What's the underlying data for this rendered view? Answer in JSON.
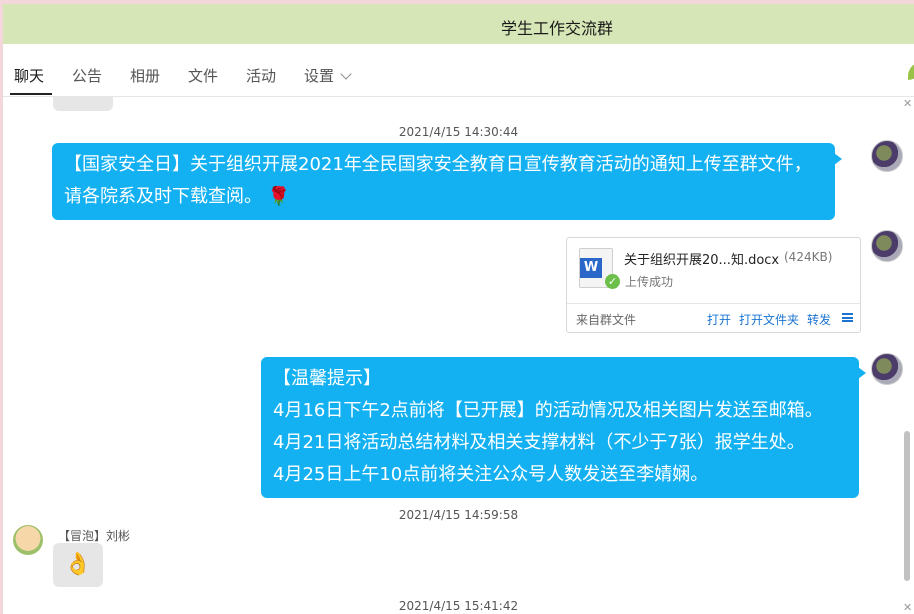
{
  "window": {
    "title": "学生工作交流群"
  },
  "tabs": [
    {
      "label": "聊天"
    },
    {
      "label": "公告"
    },
    {
      "label": "相册"
    },
    {
      "label": "文件"
    },
    {
      "label": "活动"
    },
    {
      "label": "设置"
    }
  ],
  "messages": {
    "ts1": "2021/4/15 14:30:44",
    "msg1_line1": "【国家安全日】关于组织开展2021年全民国家安全教育日宣传教育活动的通知上传至群文件，",
    "msg1_line2": "请各院系及时下载查阅。",
    "msg1_emoji": "🌹",
    "file": {
      "name": "关于组织开展20...知.docx",
      "size": "(424KB)",
      "status": "上传成功",
      "source": "来自群文件",
      "open": "打开",
      "open_folder": "打开文件夹",
      "forward": "转发"
    },
    "notice": {
      "line1": "【温馨提示】",
      "line2": "4月16日下午2点前将【已开展】的活动情况及相关图片发送至邮箱。",
      "line3": "4月21日将活动总结材料及相关支撑材料（不少于7张）报学生处。",
      "line4": "4月25日上午10点前将关注公众号人数发送至李婧娴。"
    },
    "ts2": "2021/4/15 14:59:58",
    "sender": "【冒泡】刘彬",
    "ok_emoji": "👌",
    "ts3": "2021/4/15 15:41:42"
  }
}
